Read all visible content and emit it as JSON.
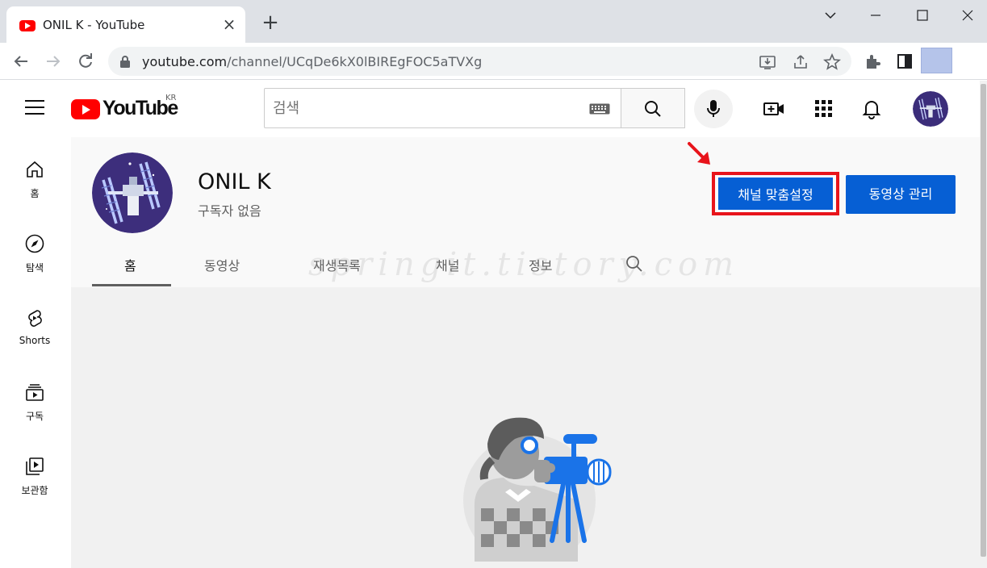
{
  "browser": {
    "tab_title": "ONIL K - YouTube",
    "url_host": "youtube.com",
    "url_path": "/channel/UCqDe6kX0lBIREgFOC5aTVXg"
  },
  "masthead": {
    "logo_text": "YouTube",
    "region": "KR",
    "search_placeholder": "검색"
  },
  "guide": {
    "items": [
      {
        "label": "홈",
        "icon": "home-icon"
      },
      {
        "label": "탐색",
        "icon": "compass-icon"
      },
      {
        "label": "Shorts",
        "icon": "shorts-icon"
      },
      {
        "label": "구독",
        "icon": "subscriptions-icon"
      },
      {
        "label": "보관함",
        "icon": "library-icon"
      }
    ]
  },
  "channel": {
    "name": "ONIL K",
    "subscribers": "구독자 없음",
    "customize_label": "채널 맞춤설정",
    "manage_label": "동영상 관리",
    "tabs": [
      "홈",
      "동영상",
      "재생목록",
      "채널",
      "정보"
    ],
    "active_tab": "홈"
  },
  "watermark": "springit.tistory.com",
  "colors": {
    "accent_blue": "#065fd4",
    "highlight_red": "#e8141b",
    "youtube_red": "#ff0000"
  }
}
